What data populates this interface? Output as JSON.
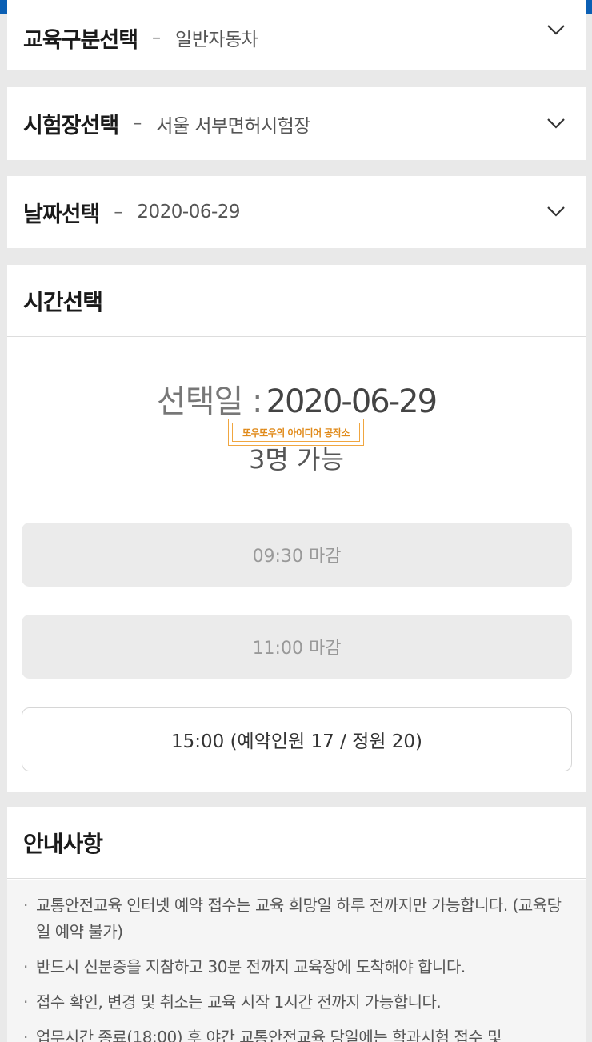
{
  "selectors": [
    {
      "label": "교육구분선택",
      "value": "일반자동차"
    },
    {
      "label": "시험장선택",
      "value": "서울 서부면허시험장"
    },
    {
      "label": "날짜선택",
      "value": "2020-06-29"
    }
  ],
  "dash": "–",
  "time_section": {
    "title": "시간선택",
    "selected_day_label": "선택일 :",
    "selected_day_value": "2020-06-29",
    "availability": "3명 가능",
    "watermark": "또우또우의 아이디어 공작소",
    "slots": [
      {
        "label": "09:30 마감",
        "status": "closed"
      },
      {
        "label": "11:00 마감",
        "status": "closed"
      },
      {
        "label": "15:00 (예약인원 17 / 정원 20)",
        "status": "open"
      }
    ]
  },
  "notice": {
    "title": "안내사항",
    "items": [
      "교통안전교육 인터넷 예약 접수는 교육 희망일 하루 전까지만 가능합니다. (교육당일 예약 불가)",
      "반드시 신분증을 지참하고 30분 전까지 교육장에 도착해야 합니다.",
      "접수 확인, 변경 및 취소는 교육 시작 1시간 전까지 가능합니다.",
      "업무시간 종료(18:00) 후 야간 교통안전교육 당일에는 학과시험 접수 및"
    ]
  },
  "colors": {
    "topbar": "#0a5fb4",
    "accent_watermark": "#e08a1a"
  },
  "icons": {
    "selector_toggle": "chevron-down-icon"
  }
}
